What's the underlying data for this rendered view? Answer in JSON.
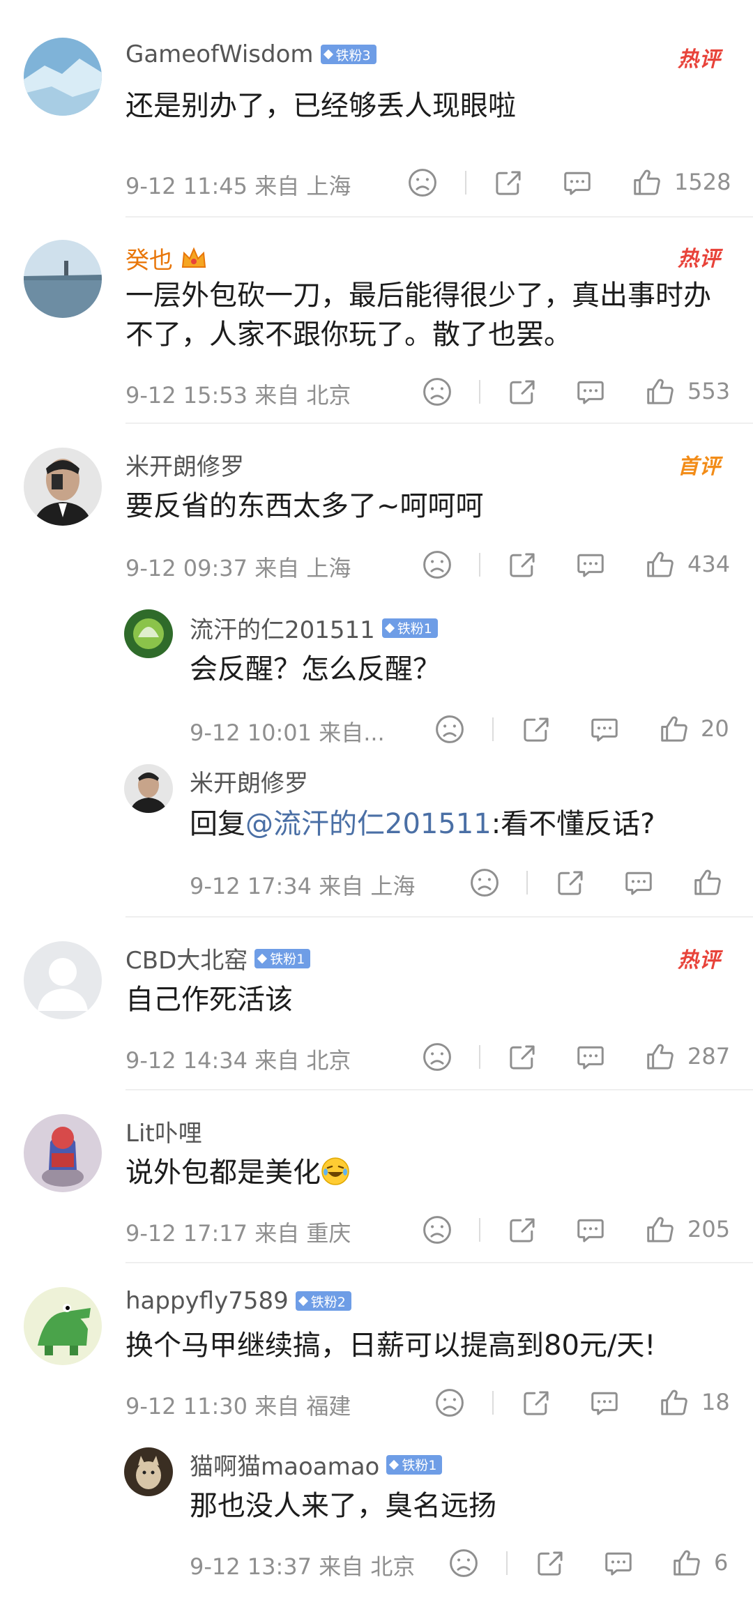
{
  "comments": [
    {
      "user": "GameofWisdom",
      "fan": "铁粉3",
      "tag": "热评",
      "text": "还是别办了，已经够丢人现眼啦",
      "meta": "9-12 11:45 来自 上海",
      "likes": "1528"
    },
    {
      "user": "癸也",
      "fan": "",
      "tag": "热评",
      "text": "一层外包砍一刀，最后能得很少了，真出事时办不了，人家不跟你玩了。散了也罢。",
      "meta": "9-12 15:53 来自 北京",
      "likes": "553"
    },
    {
      "user": "米开朗修罗",
      "fan": "",
      "tag": "首评",
      "text": "要反省的东西太多了~呵呵呵",
      "meta": "9-12 09:37 来自 上海",
      "likes": "434"
    },
    {
      "user": "流汗的仁201511",
      "fan": "铁粉1",
      "tag": "",
      "text": "会反醒？怎么反醒？",
      "meta": "9-12 10:01 来自...",
      "likes": "20"
    },
    {
      "user": "米开朗修罗",
      "fan": "",
      "tag": "",
      "text_prefix": "回复",
      "mention": "@流汗的仁201511",
      "text_suffix": ":看不懂反话?",
      "meta": "9-12 17:34 来自 上海",
      "likes": ""
    },
    {
      "user": "CBD大北窑",
      "fan": "铁粉1",
      "tag": "热评",
      "text": "自己作死活该",
      "meta": "9-12 14:34 来自 北京",
      "likes": "287"
    },
    {
      "user": "Lit卟哩",
      "fan": "",
      "tag": "",
      "text": "说外包都是美化",
      "meta": "9-12 17:17 来自 重庆",
      "likes": "205"
    },
    {
      "user": "happyfly7589",
      "fan": "铁粉2",
      "tag": "",
      "text": "换个马甲继续搞，日薪可以提高到80元/天!",
      "meta": "9-12 11:30 来自 福建",
      "likes": "18"
    },
    {
      "user": "猫啊猫maoamao",
      "fan": "铁粉1",
      "tag": "",
      "text": "那也没人来了，臭名远扬",
      "meta": "9-12 13:37 来自 北京",
      "likes": "6"
    }
  ],
  "icons": {
    "dislike": "frown-icon",
    "share": "share-icon",
    "comment": "comment-icon",
    "like": "thumbs-up-icon"
  },
  "colors": {
    "accent_red": "#e8433a",
    "accent_orange": "#f28c18",
    "fan_badge": "#6e9de6",
    "mention": "#4a6fa5"
  }
}
